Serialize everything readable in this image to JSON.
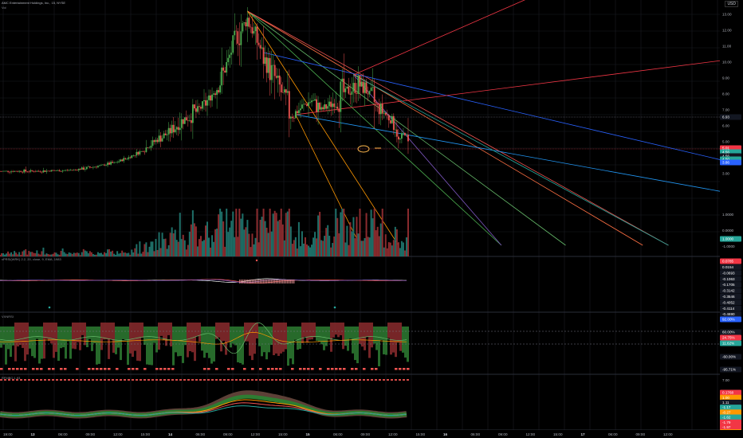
{
  "header": {
    "symbol_line": "AMC Entertainment Holdings, Inc., 15, NYSE",
    "sub": "Vol",
    "currency": "USD"
  },
  "colors": {
    "up": "#26a69a",
    "candle_up": "#4caf50",
    "candle_down": "#ef5350",
    "background": "#000000",
    "grid": "#1b1d22",
    "axis_text": "#b2b5be",
    "accent_blue": "#2962ff",
    "accent_red": "#f23645"
  },
  "price_axis": {
    "ticks": [
      "13.00",
      "12.00",
      "11.00",
      "10.00",
      "9.00",
      "8.00",
      "7.00",
      "6.00",
      "5.00",
      "4.00",
      "3.00"
    ],
    "marker_line": "6.93",
    "tags": [
      {
        "label": "5.01",
        "color": "#f23645"
      },
      {
        "label": "4.56",
        "color": "#26a69a"
      },
      {
        "label": "4.56",
        "color": "#131722"
      },
      {
        "label": "4.50",
        "color": "#26a69a"
      },
      {
        "label": "3.86",
        "color": "#2962ff"
      }
    ]
  },
  "volume_axis": {
    "ticks": [
      "1.0000",
      "0.0000",
      "-1.0000"
    ],
    "tag": "1.0000"
  },
  "time_axis": {
    "labels": [
      "19:00",
      "13",
      "06:00",
      "09:00",
      "12:00",
      "15:00",
      "14",
      "06:00",
      "09:00",
      "12:00",
      "15:00",
      "15",
      "06:00",
      "09:00",
      "12:00",
      "15:00",
      "16",
      "06:00",
      "09:00",
      "12:00",
      "15:00",
      "17",
      "06:00",
      "09:00",
      "12:00"
    ]
  },
  "pane2": {
    "title": "xPRSI(WRK) 2.2, 20, close, 9, EMA, 1983",
    "tags": [
      {
        "label": "0.0785",
        "color": "#f23645"
      },
      {
        "label": "0.0154",
        "color": "#131722"
      },
      {
        "label": "-0.0693",
        "color": "#131722"
      },
      {
        "label": "-0.1063",
        "color": "#131722"
      },
      {
        "label": "-0.1705",
        "color": "#131722"
      },
      {
        "label": "-0.3142",
        "color": "#131722"
      },
      {
        "label": "-0.3546",
        "color": "#131722"
      },
      {
        "label": "-0.4052",
        "color": "#131722"
      },
      {
        "label": "-0.4114",
        "color": "#131722"
      },
      {
        "label": "-0.4690",
        "color": "#131722"
      }
    ]
  },
  "pane3": {
    "title": "VXNRSI",
    "tags": [
      {
        "label": "60.00%",
        "color": "#131722"
      },
      {
        "label": "92.00%",
        "color": "#2962ff"
      },
      {
        "label": "24.75%",
        "color": "#f23645"
      },
      {
        "label": "11.62%",
        "color": "#26a69a"
      },
      {
        "label": "-60.00%",
        "color": "#131722"
      },
      {
        "label": "-95.71%",
        "color": "#131722"
      }
    ]
  },
  "pane4": {
    "title": "RFMBO 1.93",
    "ticks": [
      "7.00",
      "0.00",
      "-7.00"
    ],
    "tags": [
      {
        "label": "0.1768",
        "color": "#f23645"
      },
      {
        "label": "1.00",
        "color": "#ff9800"
      },
      {
        "label": "1.11",
        "color": "#131722"
      },
      {
        "label": "-1.17",
        "color": "#26a69a"
      },
      {
        "label": "-0.27",
        "color": "#ff9800"
      },
      {
        "label": "-1.62",
        "color": "#26a69a"
      },
      {
        "label": "-1.79",
        "color": "#f23645"
      },
      {
        "label": "-1.97",
        "color": "#f23645"
      },
      {
        "label": "-2.40",
        "color": "#ff9800"
      }
    ]
  },
  "chart_data": {
    "type": "candlestick",
    "title": "AMC Entertainment Holdings, Inc., 15, NYSE",
    "ylim": [
      2.3,
      13.4
    ],
    "x_range_hours": [
      0,
      112
    ],
    "price_series": [
      {
        "x": 0,
        "y": 3.15
      },
      {
        "x": 6,
        "y": 3.15
      },
      {
        "x": 10,
        "y": 3.2
      },
      {
        "x": 12,
        "y": 3.25
      },
      {
        "x": 15,
        "y": 3.45
      },
      {
        "x": 18,
        "y": 3.7
      },
      {
        "x": 20,
        "y": 4.0
      },
      {
        "x": 22,
        "y": 4.4
      },
      {
        "x": 24,
        "y": 5.0
      },
      {
        "x": 26,
        "y": 5.5
      },
      {
        "x": 28,
        "y": 6.2
      },
      {
        "x": 30,
        "y": 6.7
      },
      {
        "x": 32,
        "y": 7.4
      },
      {
        "x": 33.5,
        "y": 8.3
      },
      {
        "x": 35,
        "y": 9.5
      },
      {
        "x": 36.5,
        "y": 11.3
      },
      {
        "x": 37.5,
        "y": 12.0
      },
      {
        "x": 38.5,
        "y": 12.7
      },
      {
        "x": 40,
        "y": 11.4
      },
      {
        "x": 41,
        "y": 10.3
      },
      {
        "x": 42.5,
        "y": 9.2
      },
      {
        "x": 44,
        "y": 7.9
      },
      {
        "x": 45.5,
        "y": 6.6
      },
      {
        "x": 47,
        "y": 7.2
      },
      {
        "x": 48.5,
        "y": 7.6
      },
      {
        "x": 50,
        "y": 7.0
      },
      {
        "x": 52,
        "y": 7.5
      },
      {
        "x": 54,
        "y": 8.2
      },
      {
        "x": 56,
        "y": 8.6
      },
      {
        "x": 57,
        "y": 8.3
      },
      {
        "x": 58.5,
        "y": 7.3
      },
      {
        "x": 60,
        "y": 6.7
      },
      {
        "x": 61.5,
        "y": 6.1
      },
      {
        "x": 62,
        "y": 5.0
      },
      {
        "x": 63,
        "y": 5.6
      },
      {
        "x": 63.5,
        "y": 4.5
      }
    ],
    "trend_lines": [
      {
        "x1": 38.5,
        "y1": 13.2,
        "x2": 78,
        "y2": -1.5,
        "color": "#4caf50"
      },
      {
        "x1": 38.5,
        "y1": 13.2,
        "x2": 88,
        "y2": -1.5,
        "color": "#66bb6a"
      },
      {
        "x1": 38.5,
        "y1": 13.2,
        "x2": 100,
        "y2": -1.5,
        "color": "#ff7043"
      },
      {
        "x1": 38.5,
        "y1": 13.2,
        "x2": 104,
        "y2": -1.5,
        "color": "#ef5350"
      },
      {
        "x1": 38.5,
        "y1": 13.2,
        "x2": 62,
        "y2": -1.5,
        "color": "#ff9800"
      },
      {
        "x1": 41,
        "y1": 10.6,
        "x2": 116,
        "y2": 3.5,
        "color": "#2962ff"
      },
      {
        "x1": 46,
        "y1": 6.7,
        "x2": 116,
        "y2": 1.6,
        "color": "#2196f3"
      },
      {
        "x1": 46,
        "y1": 6.7,
        "x2": 120,
        "y2": 10.5,
        "color": "#f23645"
      },
      {
        "x1": 55,
        "y1": 9.2,
        "x2": 85,
        "y2": 14.5,
        "color": "#f23645"
      },
      {
        "x1": 55,
        "y1": 9.2,
        "x2": 104,
        "y2": -1.5,
        "color": "#26a69a"
      },
      {
        "x1": 55,
        "y1": 9.2,
        "x2": 78,
        "y2": -1.5,
        "color": "#7e57c2"
      },
      {
        "x1": 46,
        "y1": 6.7,
        "x2": 56,
        "y2": -1.5,
        "color": "#ff9800"
      }
    ]
  }
}
